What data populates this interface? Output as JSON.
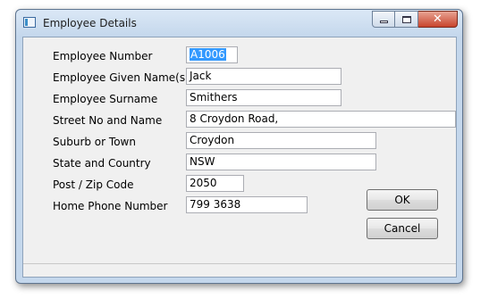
{
  "window": {
    "title": "Employee Details",
    "close_glyph": "✕"
  },
  "form": {
    "fields": [
      {
        "label": "Employee Number",
        "value": "A1006"
      },
      {
        "label": "Employee Given Name(s)",
        "value": "Jack"
      },
      {
        "label": "Employee Surname",
        "value": "Smithers"
      },
      {
        "label": "Street No and Name",
        "value": "8 Croydon Road,"
      },
      {
        "label": "Suburb or Town",
        "value": "Croydon"
      },
      {
        "label": "State and Country",
        "value": "NSW"
      },
      {
        "label": "Post / Zip Code",
        "value": "2050"
      },
      {
        "label": "Home Phone Number",
        "value": "799 3638"
      }
    ]
  },
  "buttons": {
    "ok": "OK",
    "cancel": "Cancel"
  },
  "icons": {
    "app": "app-window-icon",
    "minimize": "minimize-icon",
    "maximize": "maximize-icon",
    "close": "close-icon"
  },
  "colors": {
    "frame": "#c4d7ec",
    "client": "#f0f0f0",
    "close_button": "#c8442c",
    "selection": "#3399ff"
  }
}
